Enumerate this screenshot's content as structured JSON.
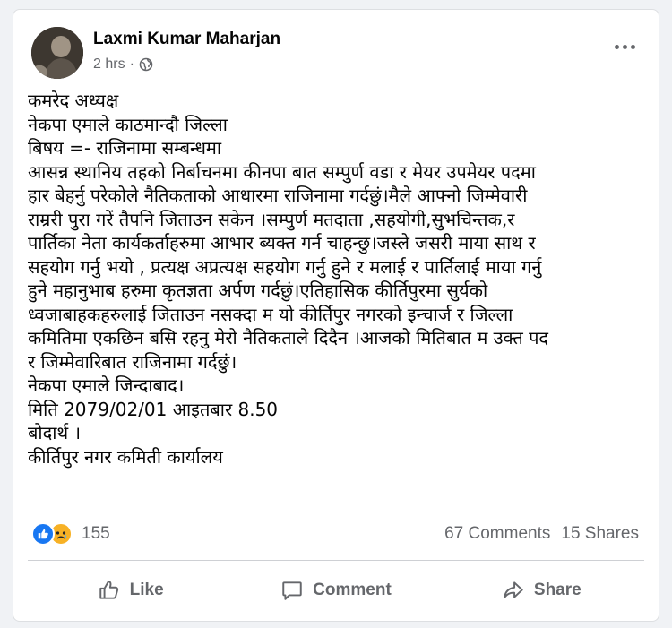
{
  "post": {
    "author": "Laxmi Kumar Maharjan",
    "time": "2 hrs",
    "separator": "·",
    "body_lines": [
      "कमरेद अध्यक्ष",
      "नेकपा एमाले काठमान्दौ जिल्ला",
      "बिषय =- राजिनामा सम्बन्धमा",
      "आसन्न स्थानिय तहको निर्बाचनमा कीनपा बात सम्पुर्ण वडा र मेयर उपमेयर पदमा",
      "हार बेहर्नु परेकोले नैतिकताको आधारमा राजिनामा गर्दछुं।मैले आफ्नो जिम्मेवारी",
      "राम्ररी पुरा गरें तैपनि जिताउन सकेन ।सम्पुर्ण मतदाता ,सहयोगी,सुभचिन्तक,र",
      "पार्तिका नेता कार्यकर्ताहरुमा आभार ब्यक्त गर्न चाहन्छु।जस्ले जसरी माया साथ र",
      "सहयोग गर्नु भयो , प्रत्यक्ष अप्रत्यक्ष  सहयोग गर्नु हुने र मलाई र पार्तिलाई माया गर्नु",
      "हुने महानुभाब हरुमा कृतज्ञता अर्पण गर्दछुं।एतिहासिक कीर्तिपुरमा सुर्यको",
      "ध्वजाबाहकहरुलाई जिताउन नसक्दा म यो कीर्तिपुर नगरको इन्चार्ज र जिल्ला",
      "कमितिमा एकछिन बसि रहनु मेरो नैतिकताले दिदैन ।आजको मितिबात म उक्त पद",
      "र जिम्मेवारिबात राजिनामा गर्दछुं।",
      "नेकपा एमाले जिन्दाबाद।",
      "मिति 2079/02/01 आइतबार 8.50",
      "बोदार्थ ।",
      "कीर्तिपुर नगर कमिती कार्यालय"
    ]
  },
  "reactions": {
    "types": [
      "like",
      "sad"
    ],
    "count": "155",
    "comments": "67 Comments",
    "shares": "15 Shares"
  },
  "actions": {
    "like": "Like",
    "comment": "Comment",
    "share": "Share"
  },
  "icons": {
    "audience": "globe-icon",
    "menu": "more-options-icon",
    "like": "thumbs-up-icon",
    "comment": "speech-bubble-icon",
    "share": "share-arrow-icon"
  },
  "colors": {
    "like_blue": "#1877f2",
    "sad_yellow": "#f7b125",
    "secondary_text": "#65676b"
  }
}
